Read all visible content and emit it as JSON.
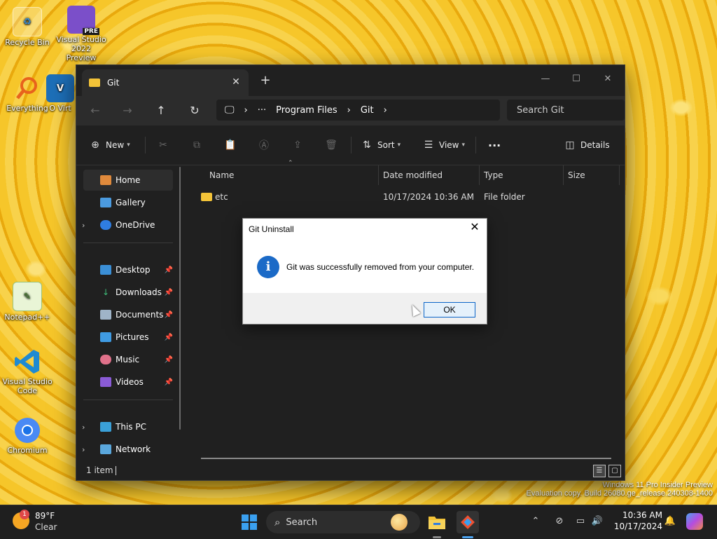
{
  "desktop": {
    "icons": [
      {
        "label": "Recycle Bin"
      },
      {
        "label": "Visual Studio 2022 Preview",
        "badge": "PRE"
      },
      {
        "label": "Everything"
      },
      {
        "label": "O Virt"
      },
      {
        "label": "Notepad++"
      },
      {
        "label": "Visual Studio Code"
      },
      {
        "label": "Chromium"
      }
    ],
    "watermark": {
      "line1": "Windows 11 Pro Insider Preview",
      "line2": "Evaluation copy. Build 26080.ge_release.240308-1400"
    }
  },
  "explorer": {
    "tab_title": "Git",
    "breadcrumb": [
      "Program Files",
      "Git"
    ],
    "breadcrumb_more": "···",
    "search_placeholder": "Search Git",
    "toolbar": {
      "new_label": "New",
      "sort_label": "Sort",
      "view_label": "View",
      "more_label": "···",
      "details_label": "Details"
    },
    "sidebar": {
      "items": [
        {
          "label": "Home"
        },
        {
          "label": "Gallery"
        },
        {
          "label": "OneDrive"
        },
        {
          "label": "Desktop"
        },
        {
          "label": "Downloads"
        },
        {
          "label": "Documents"
        },
        {
          "label": "Pictures"
        },
        {
          "label": "Music"
        },
        {
          "label": "Videos"
        },
        {
          "label": "This PC"
        },
        {
          "label": "Network"
        }
      ]
    },
    "columns": [
      "Name",
      "Date modified",
      "Type",
      "Size"
    ],
    "files": [
      {
        "name": "etc",
        "date": "10/17/2024 10:36 AM",
        "type": "File folder",
        "size": ""
      }
    ],
    "status": "1 item"
  },
  "dialog": {
    "title": "Git Uninstall",
    "message": "Git was successfully removed from your computer.",
    "ok_label": "OK"
  },
  "taskbar": {
    "weather_temp": "89°F",
    "weather_desc": "Clear",
    "weather_badge": "1",
    "search_label": "Search",
    "time": "10:36 AM",
    "date": "10/17/2024"
  },
  "colors": {
    "accent": "#0a64c8",
    "folder": "#f3c338",
    "info": "#1b6ac7"
  }
}
